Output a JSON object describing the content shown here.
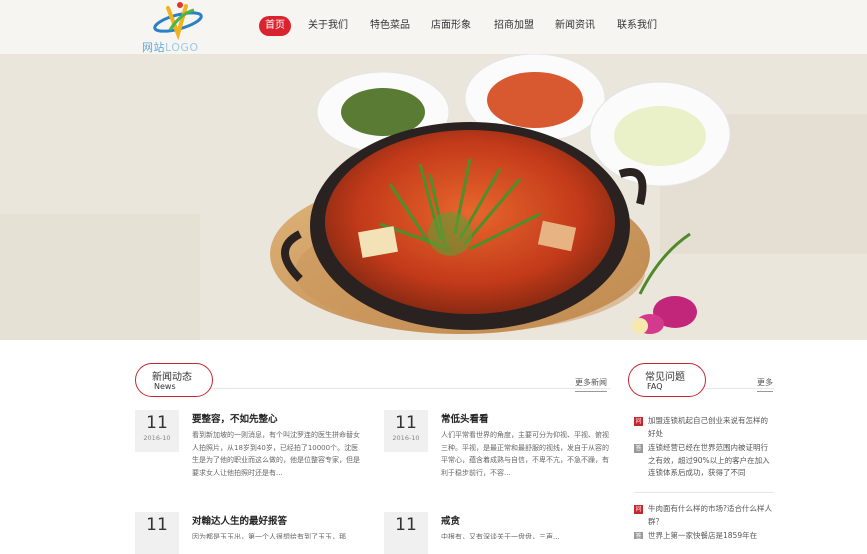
{
  "logo": {
    "text_cn": "网站",
    "text_en": "LOGO"
  },
  "nav": [
    {
      "label": "首页",
      "active": true
    },
    {
      "label": "关于我们"
    },
    {
      "label": "特色菜品"
    },
    {
      "label": "店面形象"
    },
    {
      "label": "招商加盟"
    },
    {
      "label": "新闻资讯"
    },
    {
      "label": "联系我们"
    }
  ],
  "news_section": {
    "title_cn": "新闻动态",
    "title_en": "News",
    "more": "更多新闻"
  },
  "faq_section": {
    "title_cn": "常见问题",
    "title_en": "FAQ",
    "more": "更多"
  },
  "news": [
    {
      "day": "11",
      "ym": "2016-10",
      "title": "要整容，不如先整心",
      "body": "看到新加坡的一则消息，有个叫沈罗连的医生拼命替女人拍照片，从18岁到40岁，已经拍了10000个。沈医生是为了他的职业而这么做的，他是位整容专家，但是要求女人让他拍照时还是有..."
    },
    {
      "day": "11",
      "ym": "2016-10",
      "title": "常低头看看",
      "body": "人们平常看世界的角度，主要可分为仰视、平视、俯视三种。平视，是最正常和最舒服的视线，发自于从容的平常心，蕴含着成熟与自信，不卑不亢，不急不躁，有利于稳步前行，不容..."
    },
    {
      "day": "11",
      "ym": "",
      "title": "对翰达人生的最好报答",
      "body": "因为都是玉玉出，第一个人很想给有到了玉玉，那"
    },
    {
      "day": "11",
      "ym": "",
      "title": "戒贪",
      "body": "中根有，又有深谈关于一盘盘，三声..."
    }
  ],
  "faq": [
    {
      "tag": "问",
      "text": "加盟连锁机起自己创业来说有怎样的好处"
    },
    {
      "tag": "答",
      "text": "连锁经营已经在世界范围内被证明行之有效，超过90%以上的客户在加入连锁体系后成功，获得了不同"
    },
    {
      "tag": "问",
      "text": "牛肉面有什么样的市场?适合什么样人群？"
    },
    {
      "tag": "答",
      "text": "世界上第一家快餐店是1859年在"
    }
  ]
}
